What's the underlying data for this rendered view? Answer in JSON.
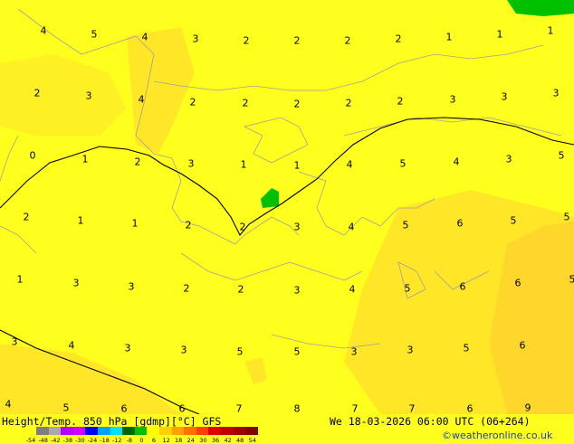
{
  "title_left": "Height/Temp. 850 hPa [gdmp][°C] GFS",
  "title_right": "We 18-03-2026 06:00 UTC (06+264)",
  "credit": "©weatheronline.co.uk",
  "colorbar": {
    "labels": [
      "-54",
      "-48",
      "-42",
      "-38",
      "-30",
      "-24",
      "-18",
      "-12",
      "-8",
      "0",
      "6",
      "12",
      "18",
      "24",
      "30",
      "36",
      "42",
      "48",
      "54"
    ],
    "colors": [
      "#7f7f7f",
      "#a9a9a9",
      "#b400ff",
      "#d200ff",
      "#0000ff",
      "#00a0ff",
      "#00e0ff",
      "#006400",
      "#00c000",
      "#ffff00",
      "#ffd000",
      "#ffa000",
      "#ff7000",
      "#ff4000",
      "#e00000",
      "#c00000",
      "#a00000",
      "#800000"
    ]
  },
  "temps": [
    {
      "v": "4"
    },
    {
      "v": "5"
    },
    {
      "v": "4"
    },
    {
      "v": "3"
    },
    {
      "v": "2"
    },
    {
      "v": "2"
    },
    {
      "v": "2"
    },
    {
      "v": "2"
    },
    {
      "v": "1"
    },
    {
      "v": "1"
    },
    {
      "v": "1"
    },
    {
      "v": "2"
    },
    {
      "v": "3"
    },
    {
      "v": "4"
    },
    {
      "v": "2"
    },
    {
      "v": "2"
    },
    {
      "v": "2"
    },
    {
      "v": "2"
    },
    {
      "v": "2"
    },
    {
      "v": "3"
    },
    {
      "v": "3"
    },
    {
      "v": "3"
    },
    {
      "v": "0"
    },
    {
      "v": "1"
    },
    {
      "v": "2"
    },
    {
      "v": "3"
    },
    {
      "v": "1"
    },
    {
      "v": "1"
    },
    {
      "v": "4"
    },
    {
      "v": "5"
    },
    {
      "v": "4"
    },
    {
      "v": "3"
    },
    {
      "v": "5"
    },
    {
      "v": "2"
    },
    {
      "v": "1"
    },
    {
      "v": "1"
    },
    {
      "v": "2"
    },
    {
      "v": "2"
    },
    {
      "v": "3"
    },
    {
      "v": "4"
    },
    {
      "v": "5"
    },
    {
      "v": "6"
    },
    {
      "v": "5"
    },
    {
      "v": "5"
    },
    {
      "v": "1"
    },
    {
      "v": "3"
    },
    {
      "v": "3"
    },
    {
      "v": "2"
    },
    {
      "v": "2"
    },
    {
      "v": "3"
    },
    {
      "v": "4"
    },
    {
      "v": "5"
    },
    {
      "v": "6"
    },
    {
      "v": "6"
    },
    {
      "v": "5"
    },
    {
      "v": "3"
    },
    {
      "v": "4"
    },
    {
      "v": "3"
    },
    {
      "v": "3"
    },
    {
      "v": "5"
    },
    {
      "v": "5"
    },
    {
      "v": "3"
    },
    {
      "v": "3"
    },
    {
      "v": "5"
    },
    {
      "v": "6"
    },
    {
      "v": "4"
    },
    {
      "v": "5"
    },
    {
      "v": "6"
    },
    {
      "v": "6"
    },
    {
      "v": "7"
    },
    {
      "v": "8"
    },
    {
      "v": "7"
    },
    {
      "v": "7"
    },
    {
      "v": "6"
    },
    {
      "v": "9"
    }
  ]
}
